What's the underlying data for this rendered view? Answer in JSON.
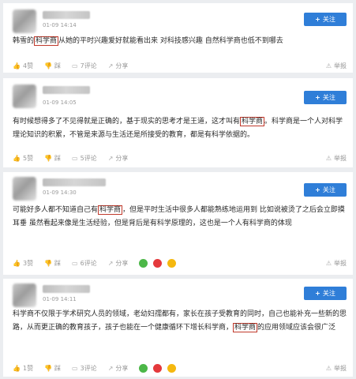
{
  "common": {
    "follow_label": "关注",
    "like_suffix": "赞",
    "dislike_label": "踩",
    "comment_suffix": "评论",
    "share_label": "分享",
    "report_label": "举报"
  },
  "posts": [
    {
      "time": "01-09 14:14",
      "body_before": "韩雪的",
      "highlight": "科学商",
      "body_after": "从她的平时兴趣爱好就能看出来 对科技感兴趣 自然科学商也低不到哪去",
      "likes": "4",
      "comments": "7"
    },
    {
      "time": "01-09 14:05",
      "body_before": "有时候想得多了不见得就是正确的，基于现实的思考才是王道，这才叫有",
      "highlight": "科学商",
      "body_after": "。科学商是一个人对科学理论知识的积累，不管是来源与生活还是所接受的教育，都是有科学依据的。",
      "likes": "5",
      "comments": "5"
    },
    {
      "time": "01-09 14:30",
      "body_before": "可能好多人都不知道自己有",
      "highlight": "科学商",
      "body_after": "，但是平时生活中很多人都能熟练地运用到 比如说被烫了之后会立即摸耳垂 虽然看起来像是生活经验，但是背后是有科学原理的，这也是一个人有科学商的体现",
      "likes": "3",
      "comments": "6"
    },
    {
      "time": "01-09 14:11",
      "body_before": "科学商不仅限于学术研究人员的领域，老幼妇孺都有，家长在孩子受教育的同时，自己也能补充一些新的思路，从而更正确的教育孩子，孩子也能在一个健康循环下增长科学商，",
      "highlight": "科学商",
      "body_after": "的应用领域应该会很广泛",
      "likes": "1",
      "comments": "3"
    }
  ],
  "colors": {
    "follow_bg": "#2f7ed8",
    "highlight_border": "#c0392b",
    "wechat": "#4cb748",
    "weibo": "#e4393c",
    "qzone": "#f5b80f"
  },
  "icons": [
    "thumb-up-icon",
    "thumb-down-icon",
    "comment-icon",
    "share-icon",
    "report-icon",
    "wechat-icon",
    "weibo-icon",
    "qzone-icon",
    "plus-icon"
  ]
}
